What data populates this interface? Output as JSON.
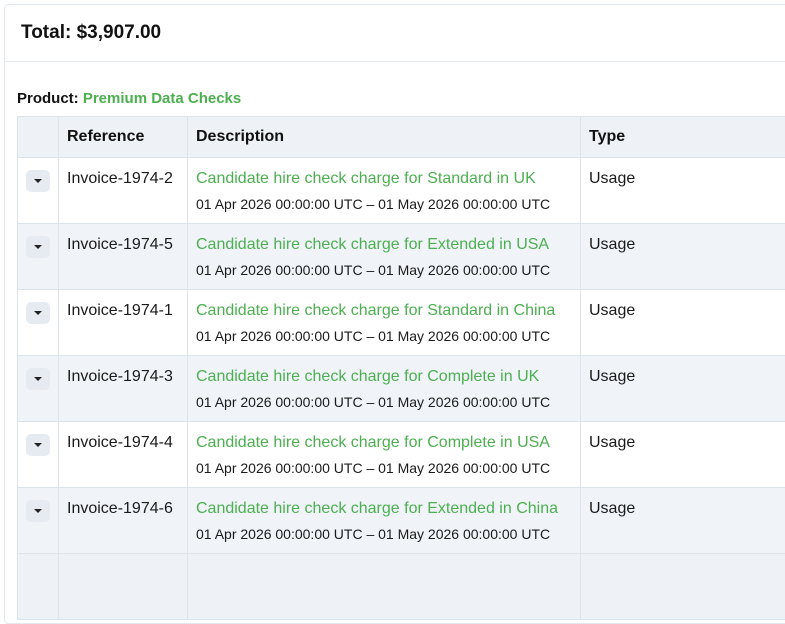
{
  "summary": {
    "total_label": "Total:",
    "total_value": "$3,907.00"
  },
  "product": {
    "label": "Product:",
    "name": "Premium Data Checks"
  },
  "table": {
    "headers": {
      "expand": "",
      "reference": "Reference",
      "description": "Description",
      "type": "Type"
    },
    "rows": [
      {
        "reference": "Invoice-1974-2",
        "description": "Candidate hire check charge for Standard in UK",
        "period": "01 Apr 2026 00:00:00 UTC – 01 May 2026 00:00:00 UTC",
        "type": "Usage"
      },
      {
        "reference": "Invoice-1974-5",
        "description": "Candidate hire check charge for Extended in USA",
        "period": "01 Apr 2026 00:00:00 UTC – 01 May 2026 00:00:00 UTC",
        "type": "Usage"
      },
      {
        "reference": "Invoice-1974-1",
        "description": "Candidate hire check charge for Standard in China",
        "period": "01 Apr 2026 00:00:00 UTC – 01 May 2026 00:00:00 UTC",
        "type": "Usage"
      },
      {
        "reference": "Invoice-1974-3",
        "description": "Candidate hire check charge for Complete in UK",
        "period": "01 Apr 2026 00:00:00 UTC – 01 May 2026 00:00:00 UTC",
        "type": "Usage"
      },
      {
        "reference": "Invoice-1974-4",
        "description": "Candidate hire check charge for Complete in USA",
        "period": "01 Apr 2026 00:00:00 UTC – 01 May 2026 00:00:00 UTC",
        "type": "Usage"
      },
      {
        "reference": "Invoice-1974-6",
        "description": "Candidate hire check charge for Extended in China",
        "period": "01 Apr 2026 00:00:00 UTC – 01 May 2026 00:00:00 UTC",
        "type": "Usage"
      }
    ]
  },
  "icons": {
    "expand": "caret-down-icon"
  },
  "colors": {
    "accent_green": "#4caf50",
    "header_bg": "#eef2f7",
    "stripe_bg": "#f0f4f9",
    "border": "#dde3ea"
  }
}
